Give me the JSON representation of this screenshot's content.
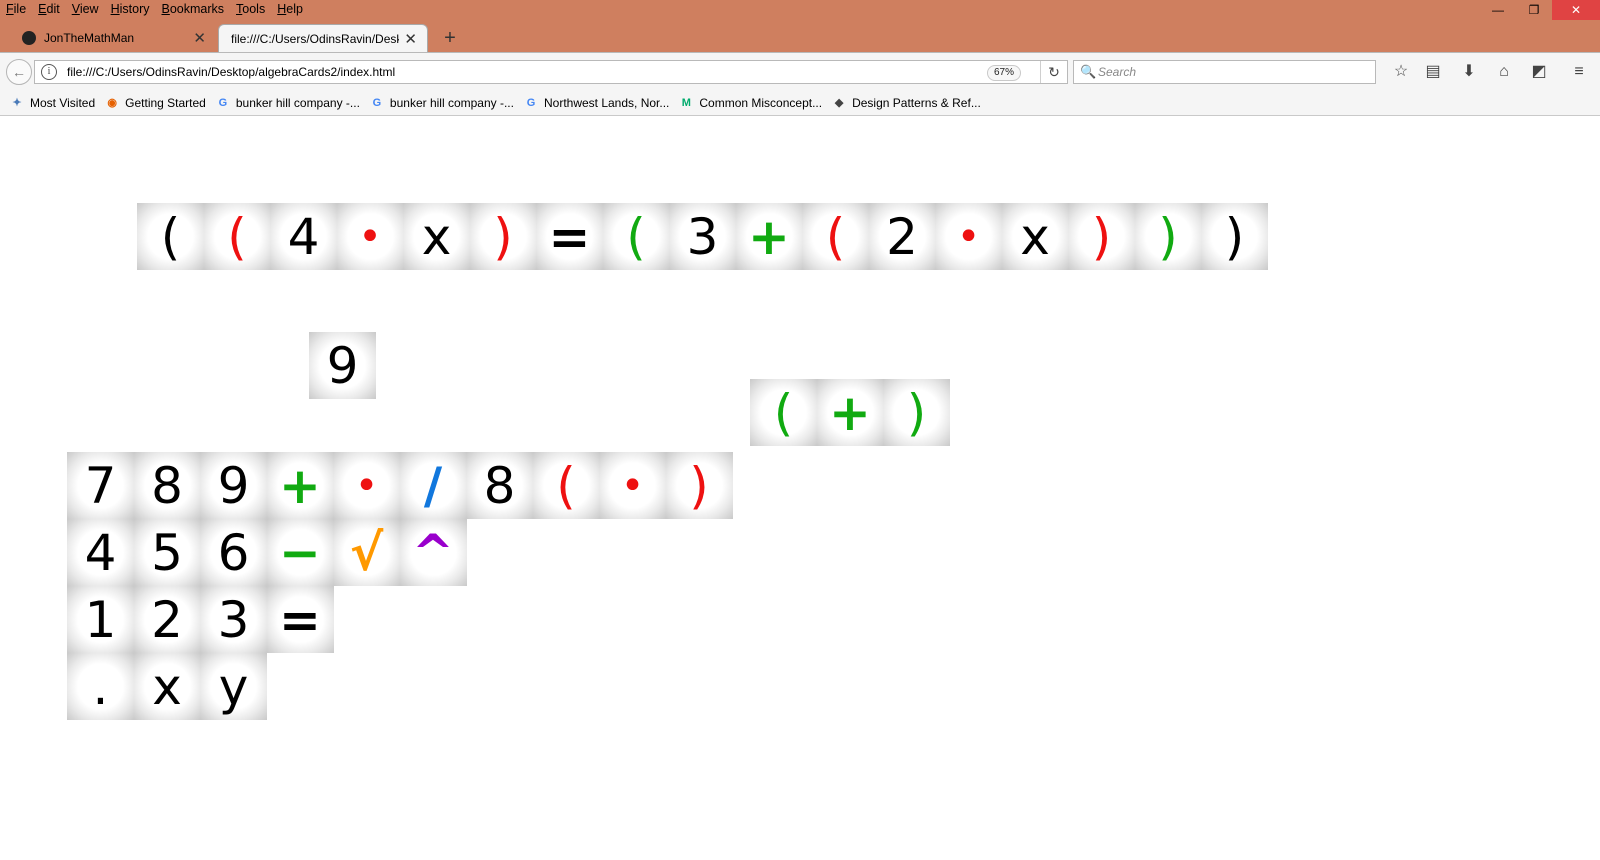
{
  "menus": [
    "File",
    "Edit",
    "View",
    "History",
    "Bookmarks",
    "Tools",
    "Help"
  ],
  "menu_accel": [
    "F",
    "E",
    "V",
    "H",
    "B",
    "T",
    "H"
  ],
  "window_controls": [
    "—",
    "❐",
    "✕"
  ],
  "tabs": [
    {
      "title": "JonTheMathMan",
      "close": "✕"
    },
    {
      "title": "file:///C:/Users/OdinsRavin/Desk",
      "close": "✕"
    }
  ],
  "new_tab": "+",
  "nav": {
    "back": "←",
    "info": "i",
    "url": "file:///C:/Users/OdinsRavin/Desktop/algebraCards2/index.html",
    "zoom": "67%",
    "reload": "↻",
    "search_placeholder": "Search",
    "search_icon": "🔍",
    "toolbar_icons": [
      "☆",
      "▤",
      "⬇",
      "⌂",
      "◩",
      "≡"
    ]
  },
  "bookmarks": [
    {
      "label": "Most Visited",
      "icon": "most-visited-icon"
    },
    {
      "label": "Getting Started",
      "icon": "firefox-icon"
    },
    {
      "label": "bunker hill company -...",
      "icon": "google-icon"
    },
    {
      "label": "bunker hill company -...",
      "icon": "google-icon"
    },
    {
      "label": "Northwest Lands, Nor...",
      "icon": "google-icon"
    },
    {
      "label": "Common Misconcept...",
      "icon": "medium-icon"
    },
    {
      "label": "Design Patterns & Ref...",
      "icon": "design-icon"
    }
  ],
  "colors": {
    "titlebar": "#cf7f5f",
    "black": "#000000",
    "red": "#ee1111",
    "green": "#11aa11",
    "blue": "#1177dd",
    "orange": "#ff9900",
    "purple": "#9900cc"
  },
  "equation_cards": [
    {
      "sym": "(",
      "color": "black"
    },
    {
      "sym": "(",
      "color": "red"
    },
    {
      "sym": "4",
      "color": "black"
    },
    {
      "sym": "•",
      "color": "red"
    },
    {
      "sym": "x",
      "color": "black"
    },
    {
      "sym": ")",
      "color": "red"
    },
    {
      "sym": "=",
      "color": "black"
    },
    {
      "sym": "(",
      "color": "green"
    },
    {
      "sym": "3",
      "color": "black"
    },
    {
      "sym": "+",
      "color": "green"
    },
    {
      "sym": "(",
      "color": "red"
    },
    {
      "sym": "2",
      "color": "black"
    },
    {
      "sym": "•",
      "color": "red"
    },
    {
      "sym": "x",
      "color": "black"
    },
    {
      "sym": ")",
      "color": "red"
    },
    {
      "sym": ")",
      "color": "green"
    },
    {
      "sym": ")",
      "color": "black"
    }
  ],
  "loose_card": {
    "sym": "9",
    "color": "black"
  },
  "group_cards": [
    {
      "sym": "(",
      "color": "green"
    },
    {
      "sym": "+",
      "color": "green"
    },
    {
      "sym": ")",
      "color": "green"
    }
  ],
  "palette_rows": [
    [
      {
        "sym": "7",
        "color": "black"
      },
      {
        "sym": "8",
        "color": "black"
      },
      {
        "sym": "9",
        "color": "black"
      },
      {
        "sym": "+",
        "color": "green"
      },
      {
        "sym": "•",
        "color": "red"
      },
      {
        "sym": "/",
        "color": "blue"
      },
      {
        "sym": "8",
        "color": "black"
      },
      {
        "sym": "(",
        "color": "red"
      },
      {
        "sym": "•",
        "color": "red"
      },
      {
        "sym": ")",
        "color": "red"
      }
    ],
    [
      {
        "sym": "4",
        "color": "black"
      },
      {
        "sym": "5",
        "color": "black"
      },
      {
        "sym": "6",
        "color": "black"
      },
      {
        "sym": "−",
        "color": "green"
      },
      {
        "sym": "√",
        "color": "orange"
      },
      {
        "sym": "^",
        "color": "purple"
      }
    ],
    [
      {
        "sym": "1",
        "color": "black"
      },
      {
        "sym": "2",
        "color": "black"
      },
      {
        "sym": "3",
        "color": "black"
      },
      {
        "sym": "=",
        "color": "black"
      }
    ],
    [
      {
        "sym": ".",
        "color": "black"
      },
      {
        "sym": "x",
        "color": "black"
      },
      {
        "sym": "y",
        "color": "black"
      }
    ]
  ]
}
